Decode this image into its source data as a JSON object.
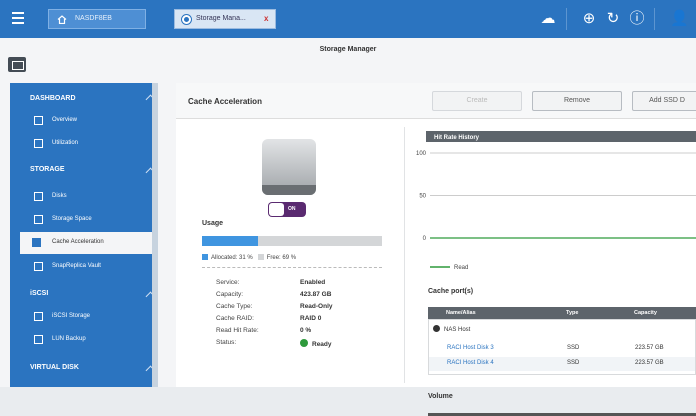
{
  "topbar": {
    "tabs": [
      {
        "label": "NASDF8EB"
      },
      {
        "label": "Storage Mana...",
        "close": "x"
      }
    ],
    "icons": [
      "cloud-icon",
      "gauge-icon",
      "sync-icon",
      "info-icon",
      "user-icon"
    ]
  },
  "window": {
    "title": "Storage Manager"
  },
  "sidebar": {
    "sections": [
      {
        "label": "DASHBOARD",
        "items": [
          "Overview",
          "Utilization"
        ]
      },
      {
        "label": "STORAGE",
        "items": [
          "Disks",
          "Storage Space",
          "Cache Acceleration",
          "SnapReplica Vault"
        ]
      },
      {
        "label": "iSCSI",
        "items": [
          "iSCSI Storage",
          "LUN Backup"
        ]
      },
      {
        "label": "VIRTUAL DISK",
        "items": []
      }
    ],
    "active_item": "Cache Acceleration"
  },
  "content": {
    "title": "Cache Acceleration",
    "buttons": {
      "create": "Create",
      "remove": "Remove",
      "add_ssd": "Add SSD D"
    },
    "toggle": "ON",
    "usage": {
      "label": "Usage",
      "allocated_pct": 31,
      "allocated_text": "Allocated: 31 %",
      "free_text": "Free: 69 %",
      "allocated_color": "#3f95e0",
      "free_color": "#d4d6d8"
    },
    "info": [
      {
        "k": "Service:",
        "v": "Enabled"
      },
      {
        "k": "Capacity:",
        "v": "423.87 GB"
      },
      {
        "k": "Cache Type:",
        "v": "Read-Only"
      },
      {
        "k": "Cache RAID:",
        "v": "RAID 0"
      },
      {
        "k": "Read Hit Rate:",
        "v": "0 %"
      },
      {
        "k": "Status:",
        "v": "Ready"
      }
    ],
    "ports_label": "Cache port(s)",
    "table": {
      "headers": [
        "Name/Alias",
        "Type",
        "Capacity"
      ],
      "group": "NAS Host",
      "rows": [
        [
          "RACI Host Disk 3",
          "SSD",
          "223.57 GB"
        ],
        [
          "RACI Host Disk 4",
          "SSD",
          "223.57 GB"
        ]
      ]
    },
    "volume_label": "Volume"
  },
  "chart_data": {
    "type": "line",
    "title": "Hit Rate History",
    "xlabel": "",
    "ylabel": "",
    "ylim": [
      0,
      100
    ],
    "yticks": [
      0,
      50,
      100
    ],
    "grid": true,
    "legend": "bottom-left",
    "series": [
      {
        "name": "Read",
        "color": "#2e9a3c",
        "values": [
          0,
          0,
          0,
          0,
          0,
          0,
          0,
          0
        ]
      }
    ]
  }
}
